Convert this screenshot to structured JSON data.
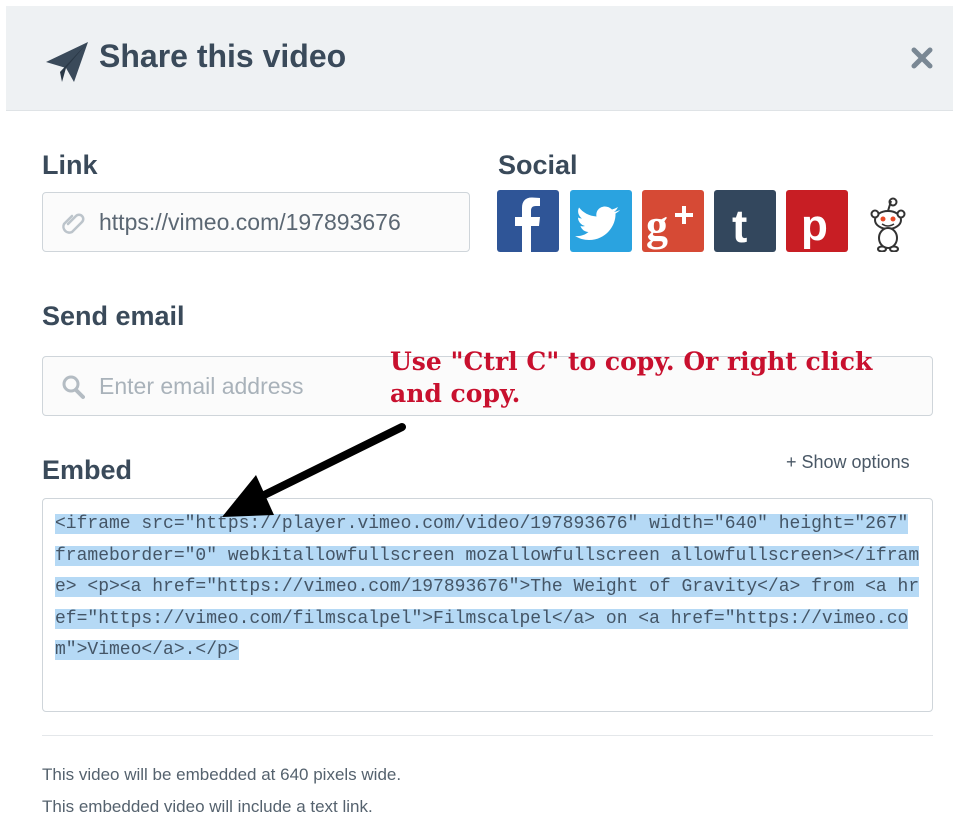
{
  "header": {
    "title": "Share this video",
    "icons": [
      "paper-plane-icon",
      "close-icon"
    ]
  },
  "link": {
    "label": "Link",
    "value": "https://vimeo.com/197893676",
    "icon": "paperclip-icon"
  },
  "social": {
    "label": "Social",
    "buttons": [
      {
        "name": "facebook",
        "color": "#2f5597"
      },
      {
        "name": "twitter",
        "color": "#2aa3e0"
      },
      {
        "name": "google-plus",
        "color": "#d64a35"
      },
      {
        "name": "tumblr",
        "color": "#33475d"
      },
      {
        "name": "pinterest",
        "color": "#c81e24"
      },
      {
        "name": "reddit",
        "color": "#ffffff"
      }
    ]
  },
  "email": {
    "label": "Send email",
    "placeholder": "Enter email address",
    "icon": "search-icon"
  },
  "annotation": {
    "text": "Use \"Ctrl C\" to copy. Or right click and copy."
  },
  "embed": {
    "label": "Embed",
    "show_options": "+ Show options",
    "code": "<iframe src=\"https://player.vimeo.com/video/197893676\" width=\"640\" height=\"267\" frameborder=\"0\" webkitallowfullscreen mozallowfullscreen allowfullscreen></iframe>\n<p><a href=\"https://vimeo.com/197893676\">The Weight of Gravity</a> from <a href=\"https://vimeo.com/filmscalpel\">Filmscalpel</a> on <a href=\"https://vimeo.com\">Vimeo</a>.</p>"
  },
  "notes": {
    "line1": "This video will be embedded at 640 pixels wide.",
    "line2": "This embedded video will include a text link."
  }
}
